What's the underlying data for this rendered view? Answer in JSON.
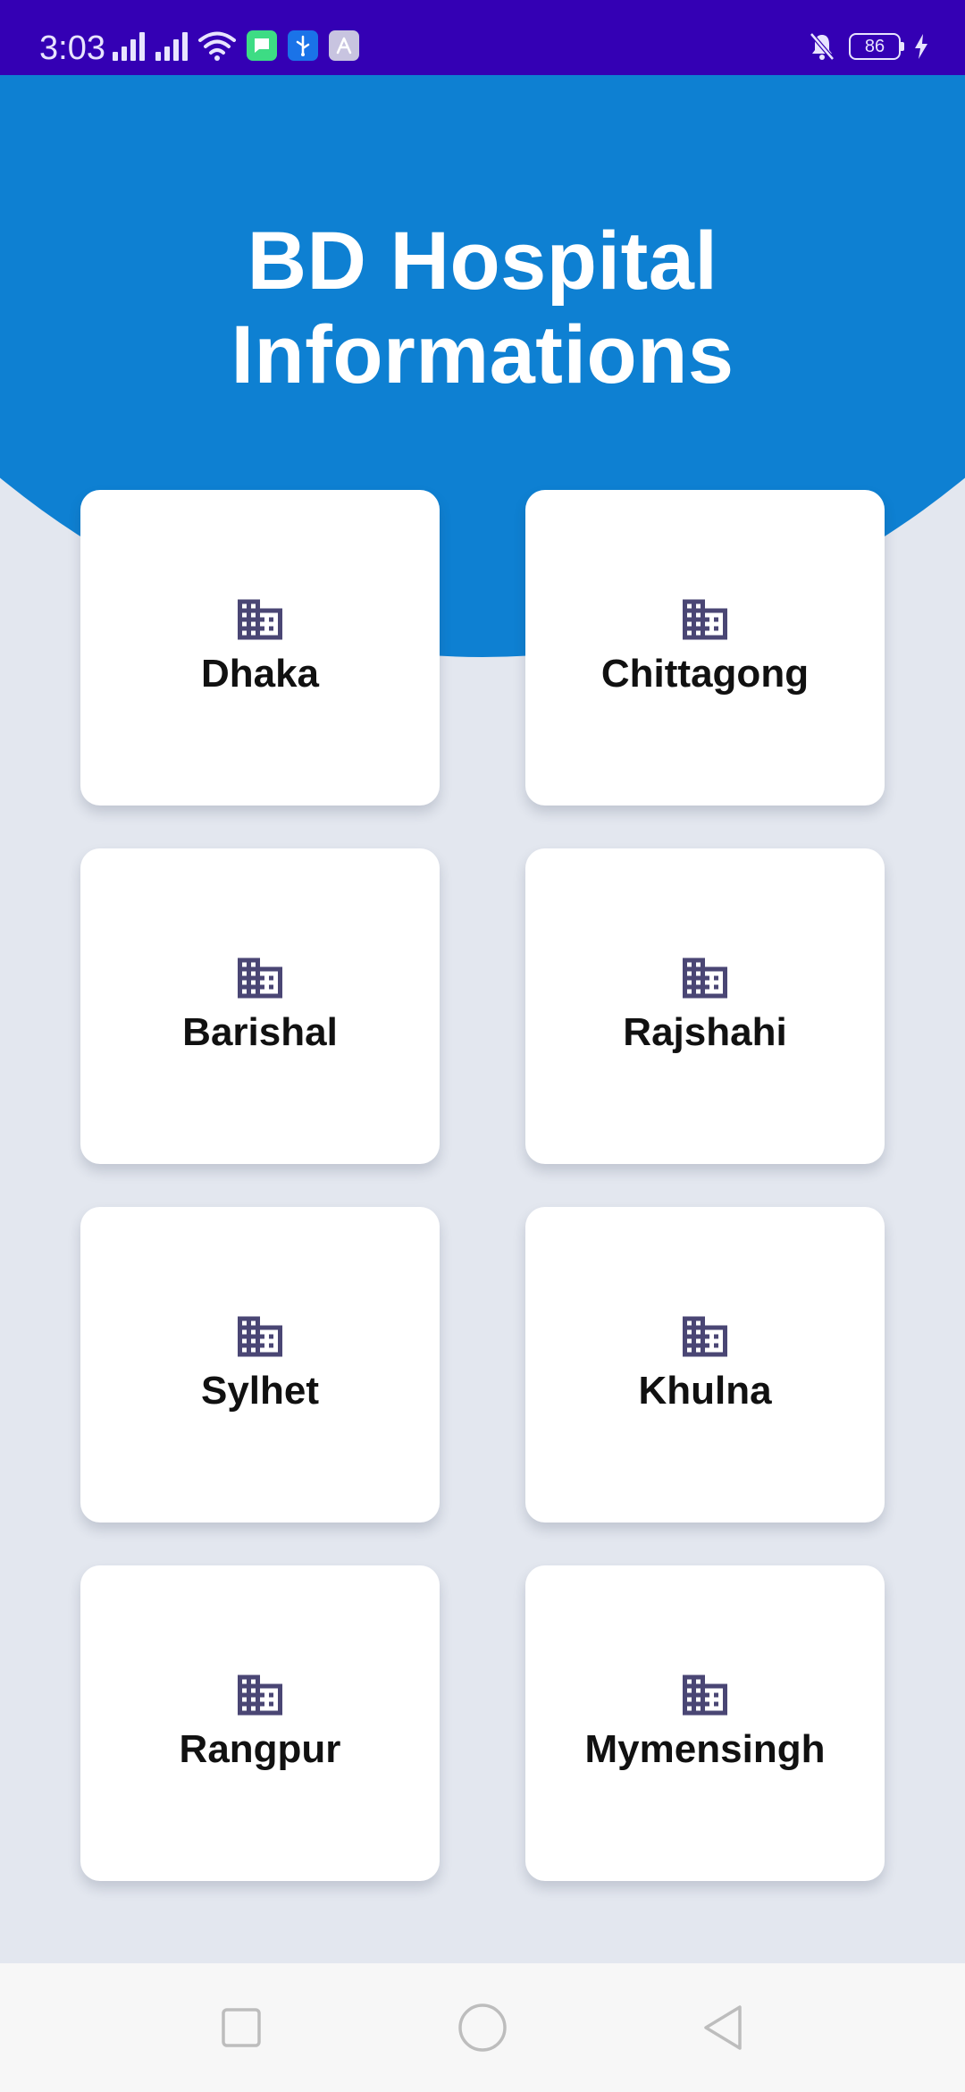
{
  "status_bar": {
    "time": "3:03",
    "battery": "86",
    "bg_color": "#3400B4",
    "left_icons": [
      "signal-icon",
      "signal-icon",
      "wifi-icon",
      "message-notification-icon",
      "usb-icon",
      "app-notification-icon"
    ],
    "right_icons": [
      "mute-icon",
      "battery-icon",
      "charging-icon"
    ]
  },
  "header": {
    "title": "BD Hospital Informations",
    "bg_color": "#0E80D2"
  },
  "divisions": [
    {
      "label": "Dhaka",
      "icon": "building-icon"
    },
    {
      "label": "Chittagong",
      "icon": "building-icon"
    },
    {
      "label": "Barishal",
      "icon": "building-icon"
    },
    {
      "label": "Rajshahi",
      "icon": "building-icon"
    },
    {
      "label": "Sylhet",
      "icon": "building-icon"
    },
    {
      "label": "Khulna",
      "icon": "building-icon"
    },
    {
      "label": "Rangpur",
      "icon": "building-icon"
    },
    {
      "label": "Mymensingh",
      "icon": "building-icon"
    }
  ],
  "colors": {
    "page_bg": "#E3E7EF",
    "card_bg": "#FFFFFF",
    "icon_color": "#4A4674",
    "label_color": "#111111"
  },
  "nav_bar": {
    "buttons": [
      "recent-apps-icon",
      "home-icon",
      "back-icon"
    ]
  }
}
